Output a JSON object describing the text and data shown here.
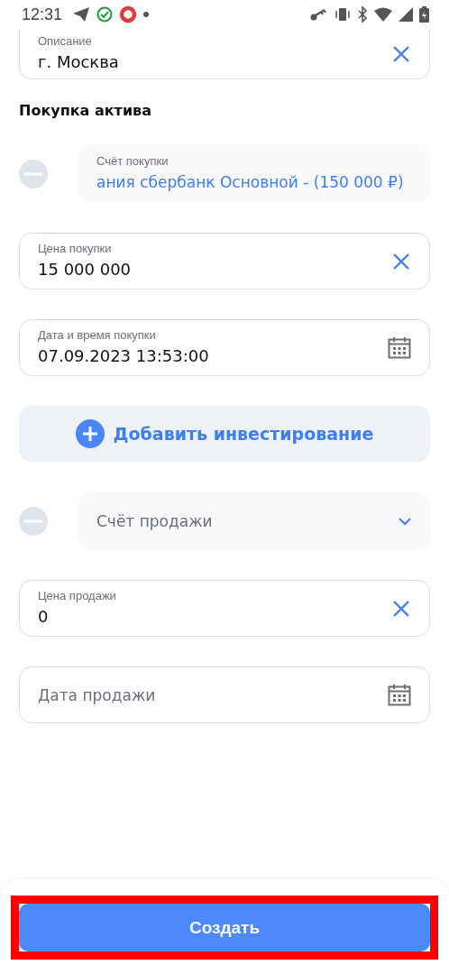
{
  "status_bar": {
    "time": "12:31"
  },
  "description_field": {
    "label": "Описание",
    "value": "г. Москва"
  },
  "section_title": "Покупка актива",
  "items": [
    {
      "kind": "select",
      "removable": true,
      "label": "Счёт покупки",
      "value": "ания сбербанк Основной - (150 000 ₽)"
    },
    {
      "kind": "clearable",
      "label": "Цена покупки",
      "value": "15 000 000"
    },
    {
      "kind": "date",
      "label": "Дата и время покупки",
      "value": "07.09.2023 13:53:00"
    },
    {
      "kind": "add",
      "label": "Добавить инвестирование"
    },
    {
      "kind": "select",
      "removable": true,
      "placeholder": "Счёт продажи"
    },
    {
      "kind": "clearable",
      "label": "Цена продажи",
      "value": "0"
    },
    {
      "kind": "date",
      "placeholder": "Дата продажи"
    }
  ],
  "submit_button": {
    "label": "Создать",
    "highlighted": true
  }
}
